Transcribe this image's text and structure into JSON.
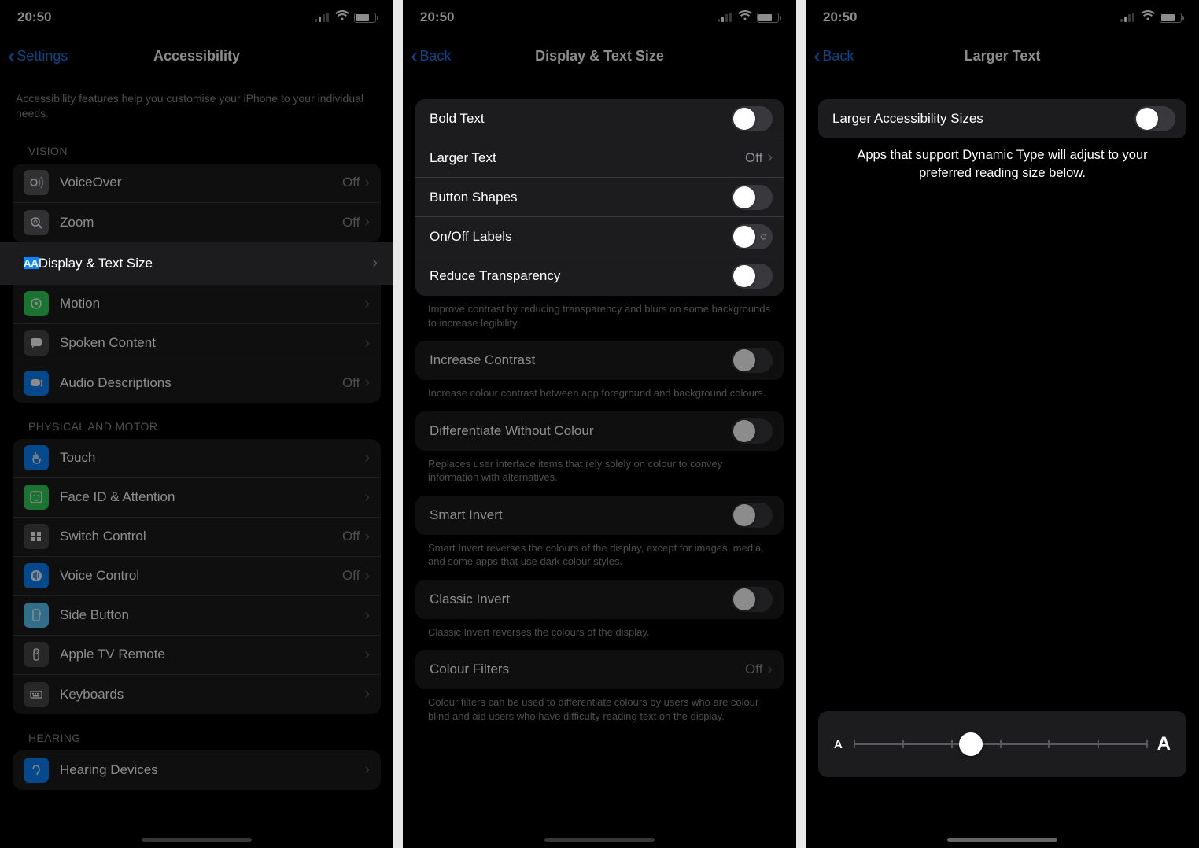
{
  "status": {
    "time": "20:50"
  },
  "phone1": {
    "back": "Settings",
    "title": "Accessibility",
    "intro": "Accessibility features help you customise your iPhone to your individual needs.",
    "sections": {
      "vision": {
        "header": "VISION",
        "items": {
          "voiceover": {
            "label": "VoiceOver",
            "trailing": "Off"
          },
          "zoom": {
            "label": "Zoom",
            "trailing": "Off"
          },
          "display": {
            "label": "Display & Text Size"
          },
          "motion": {
            "label": "Motion"
          },
          "spoken": {
            "label": "Spoken Content"
          },
          "audio": {
            "label": "Audio Descriptions",
            "trailing": "Off"
          }
        }
      },
      "physical": {
        "header": "PHYSICAL AND MOTOR",
        "items": {
          "touch": {
            "label": "Touch"
          },
          "faceid": {
            "label": "Face ID & Attention"
          },
          "switch": {
            "label": "Switch Control",
            "trailing": "Off"
          },
          "voice": {
            "label": "Voice Control",
            "trailing": "Off"
          },
          "side": {
            "label": "Side Button"
          },
          "appletv": {
            "label": "Apple TV Remote"
          },
          "keyboards": {
            "label": "Keyboards"
          }
        }
      },
      "hearing": {
        "header": "HEARING",
        "items": {
          "devices": {
            "label": "Hearing Devices"
          }
        }
      }
    }
  },
  "phone2": {
    "back": "Back",
    "title": "Display & Text Size",
    "items": {
      "bold": {
        "label": "Bold Text"
      },
      "larger": {
        "label": "Larger Text",
        "trailing": "Off"
      },
      "shapes": {
        "label": "Button Shapes"
      },
      "onoff": {
        "label": "On/Off Labels"
      },
      "transparency": {
        "label": "Reduce Transparency"
      }
    },
    "transp_footer": "Improve contrast by reducing transparency and blurs on some backgrounds to increase legibility.",
    "contrast": {
      "label": "Increase Contrast"
    },
    "contrast_footer": "Increase colour contrast between app foreground and background colours.",
    "diff": {
      "label": "Differentiate Without Colour"
    },
    "diff_footer": "Replaces user interface items that rely solely on colour to convey information with alternatives.",
    "smart": {
      "label": "Smart Invert"
    },
    "smart_footer": "Smart Invert reverses the colours of the display, except for images, media, and some apps that use dark colour styles.",
    "classic": {
      "label": "Classic Invert"
    },
    "classic_footer": "Classic Invert reverses the colours of the display.",
    "filters": {
      "label": "Colour Filters",
      "trailing": "Off"
    },
    "filters_footer": "Colour filters can be used to differentiate colours by users who are colour blind and aid users who have difficulty reading text on the display."
  },
  "phone3": {
    "back": "Back",
    "title": "Larger Text",
    "toggle_label": "Larger Accessibility Sizes",
    "info": "Apps that support Dynamic Type will adjust to your preferred reading size below.",
    "slider_small": "A",
    "slider_large": "A"
  }
}
